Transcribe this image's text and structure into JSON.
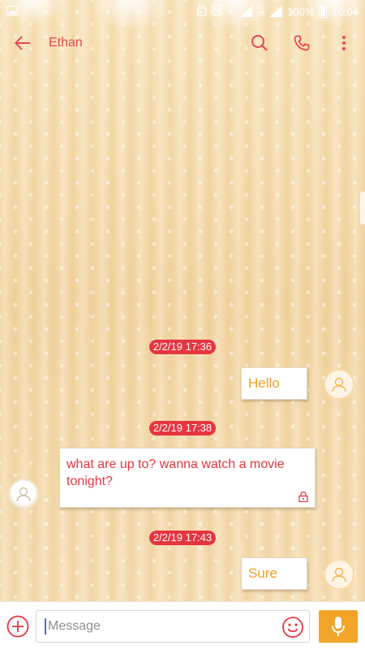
{
  "status_bar": {
    "network_top": "4G",
    "network_bottom_a": "4G",
    "network_bottom_b": "2G",
    "battery": "100%",
    "time": "16:04"
  },
  "app_bar": {
    "contact_name": "Ethan",
    "icons": [
      "back-arrow-icon",
      "search-icon",
      "phone-icon",
      "more-vert-icon"
    ]
  },
  "messages": [
    {
      "timestamp": "2/2/19 17:36",
      "direction": "outgoing",
      "text": "Hello"
    },
    {
      "timestamp": "2/2/19 17:38",
      "direction": "incoming",
      "text": "what are up to? wanna watch a movie tonight?"
    },
    {
      "timestamp": "2/2/19 17:43",
      "direction": "outgoing",
      "text": "Sure"
    }
  ],
  "compose": {
    "placeholder": "Message",
    "icons": [
      "add-circle-icon",
      "emoji-icon",
      "microphone-icon"
    ]
  },
  "colors": {
    "accent_red": "#e53640",
    "outgoing_text": "#f2a020",
    "voice_button": "#f2a528"
  }
}
